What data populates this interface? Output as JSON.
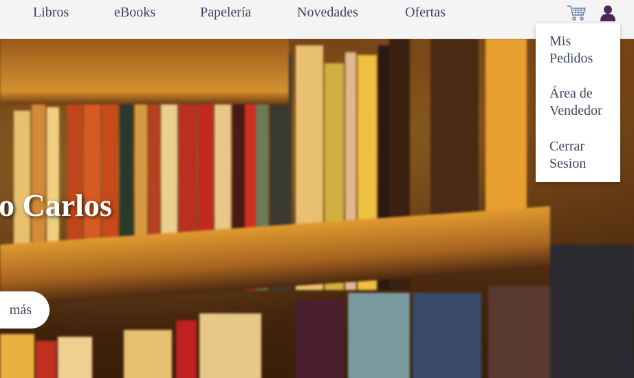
{
  "nav": {
    "items": [
      {
        "label": "Libros"
      },
      {
        "label": "eBooks"
      },
      {
        "label": "Papelería"
      },
      {
        "label": "Novedades"
      },
      {
        "label": "Ofertas"
      }
    ],
    "cart_icon": "shopping-cart-icon",
    "user_icon": "user-icon"
  },
  "user_menu": {
    "items": [
      {
        "line1": "Mis",
        "line2": "Pedidos"
      },
      {
        "line1": "Área de",
        "line2": "Vendedor"
      },
      {
        "line1": "Cerrar",
        "line2": "Sesion"
      }
    ]
  },
  "hero": {
    "title": "o Carlos",
    "button_label": "más"
  },
  "colors": {
    "nav_text": "#3d4560",
    "topbar_bg": "#f4f4f4",
    "user_icon": "#4a2a55",
    "cart_icon": "#6a7fa8"
  }
}
